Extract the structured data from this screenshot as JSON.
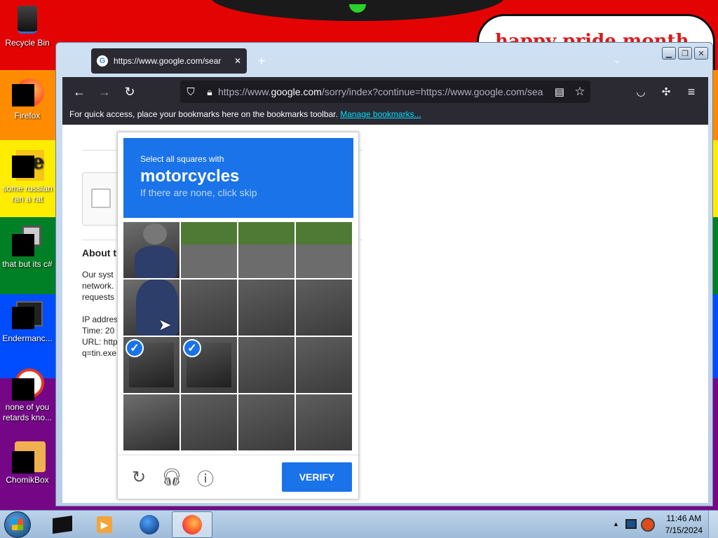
{
  "desktop": {
    "banner_text": "happy pride month",
    "icons": [
      {
        "label": "Recycle Bin",
        "icon": "recycle-bin-icon"
      },
      {
        "label": "Firefox",
        "icon": "firefox-icon"
      },
      {
        "label": "some russian ran a rat",
        "icon": "app-icon"
      },
      {
        "label": "that but its c#",
        "icon": "folder-icon"
      },
      {
        "label": "Endermanc...",
        "icon": "app-icon"
      },
      {
        "label": "none of you retards kno...",
        "icon": "app-icon"
      },
      {
        "label": "ChomikBox",
        "icon": "chomikbox-icon"
      }
    ]
  },
  "browser": {
    "tab_title": "https://www.google.com/sear",
    "url_prefix": "https://www.",
    "url_domain": "google.com",
    "url_rest": "/sorry/index?continue=https://www.google.com/sea",
    "bookmarks_text": "For quick access, place your bookmarks here on the bookmarks toolbar.",
    "bookmarks_link": "Manage bookmarks..."
  },
  "page": {
    "about_heading": "About th",
    "about_lines": [
      "Our syst",
      "network.",
      "requests",
      "",
      "IP addres",
      "Time: 20",
      "URL: http",
      "q=tin.exe"
    ]
  },
  "captcha": {
    "instruction": "Select all squares with",
    "target": "motorcycles",
    "skip_hint": "If there are none, click skip",
    "verify_label": "VERIFY",
    "selected_tiles": [
      8,
      9
    ]
  },
  "taskbar": {
    "time": "11:46 AM",
    "date": "7/15/2024"
  }
}
